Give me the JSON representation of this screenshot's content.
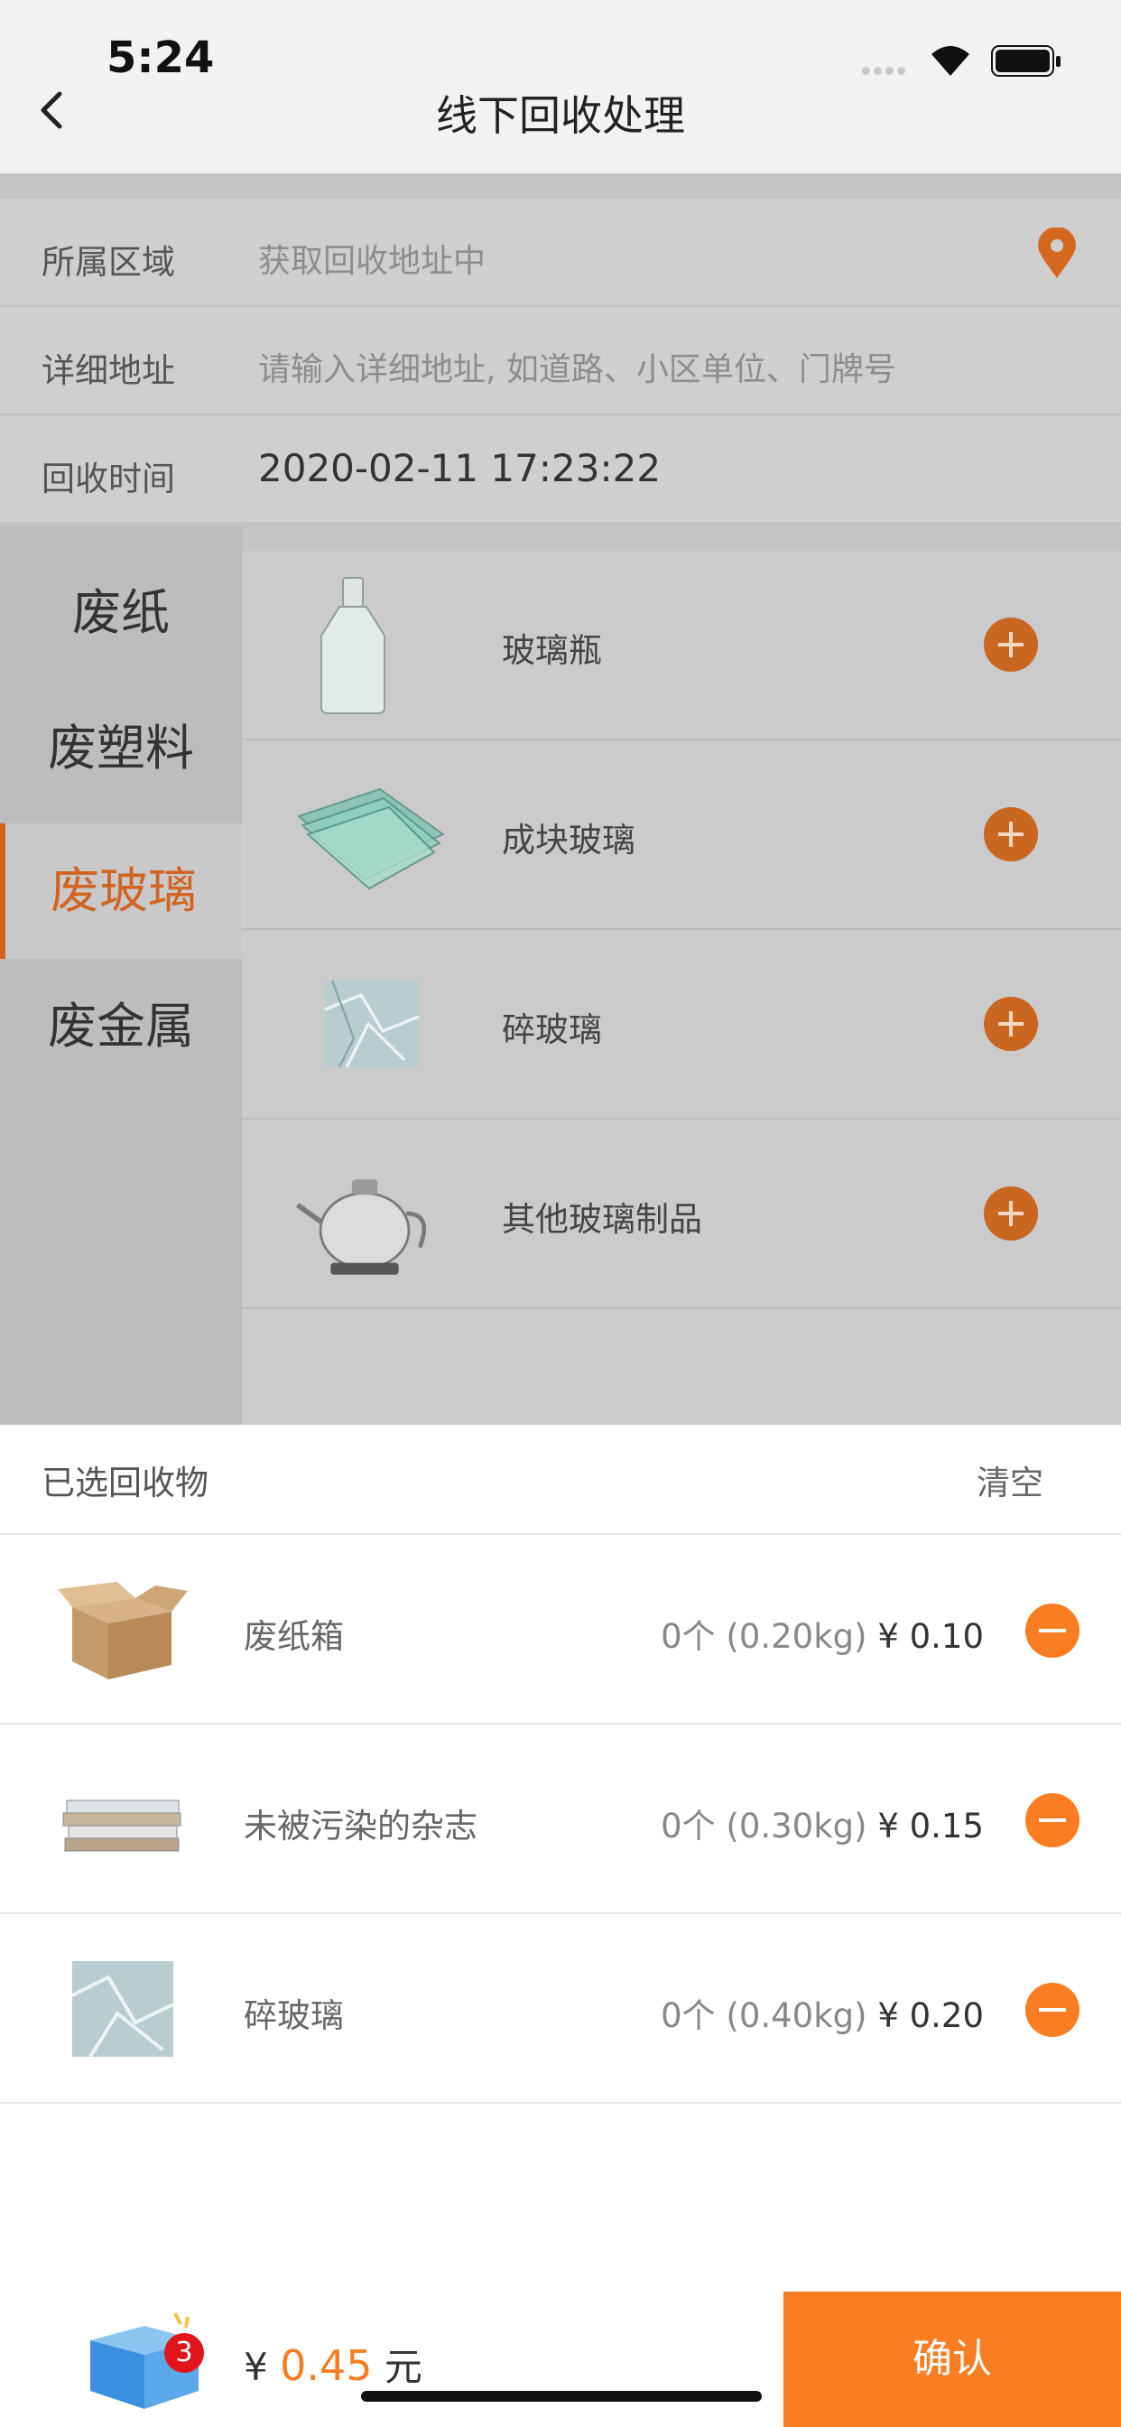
{
  "status_bar": {
    "time": "5:24"
  },
  "nav": {
    "title": "线下回收处理"
  },
  "form": {
    "region_label": "所属区域",
    "region_value": "获取回收地址中",
    "address_label": "详细地址",
    "address_placeholder": "请输入详细地址, 如道路、小区单位、门牌号",
    "time_label": "回收时间",
    "time_value": "2020-02-11 17:23:22"
  },
  "categories": [
    {
      "label": "废纸"
    },
    {
      "label": "废塑料"
    },
    {
      "label": "废玻璃",
      "active": true
    },
    {
      "label": "废金属"
    }
  ],
  "products": [
    {
      "name": "玻璃瓶",
      "icon": "glass-bottle-icon"
    },
    {
      "name": "成块玻璃",
      "icon": "glass-sheets-icon"
    },
    {
      "name": "碎玻璃",
      "icon": "broken-glass-icon"
    },
    {
      "name": "其他玻璃制品",
      "icon": "glass-kettle-icon"
    }
  ],
  "selected": {
    "title": "已选回收物",
    "clear_label": "清空",
    "items": [
      {
        "name": "废纸箱",
        "qty": "0个 (0.20kg)",
        "price": "¥ 0.10",
        "icon": "cardboard-box-icon"
      },
      {
        "name": "未被污染的杂志",
        "qty": "0个 (0.30kg)",
        "price": "¥ 0.15",
        "icon": "magazine-stack-icon"
      },
      {
        "name": "碎玻璃",
        "qty": "0个 (0.40kg)",
        "price": "¥ 0.20",
        "icon": "broken-glass-icon"
      }
    ]
  },
  "bottom": {
    "cart_count": "3",
    "currency": "¥",
    "total": "0.45",
    "unit": "元",
    "confirm_label": "确认"
  },
  "colors": {
    "accent": "#fb7d21",
    "accent_dim": "#c9661f",
    "badge": "#e1141b"
  }
}
